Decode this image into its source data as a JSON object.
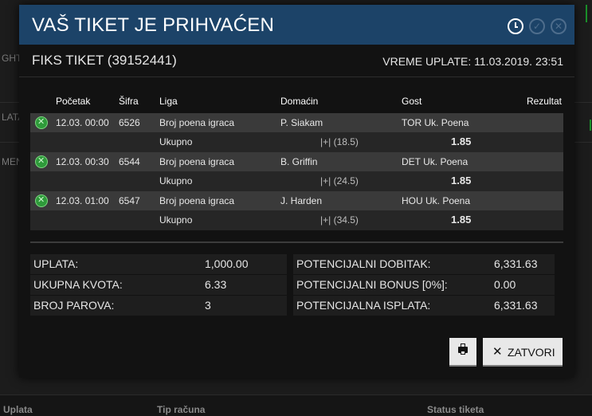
{
  "background": {
    "left_fragments": [
      "GHT",
      "LATA",
      "MEN"
    ],
    "footer_columns": [
      "Uplata",
      "Tip računa",
      "Status tiketa"
    ]
  },
  "modal": {
    "title": "VAŠ TIKET JE PRIHVAĆEN",
    "header_icons": [
      "clock-icon",
      "check-icon",
      "close-icon"
    ],
    "ticket_title": "FIKS TIKET (39152441)",
    "ticket_time": "VREME UPLATE: 11.03.2019. 23:51",
    "table": {
      "headers": [
        "Početak",
        "Šifra",
        "Liga",
        "Domaćin",
        "Gost",
        "Rezultat"
      ],
      "rows": [
        {
          "start": "12.03. 00:00",
          "code": "6526",
          "league": "Broj poena igraca",
          "home": "P. Siakam",
          "away": "TOR Uk. Poena",
          "bet": "Ukupno",
          "line": "|+| (18.5)",
          "odd": "1.85"
        },
        {
          "start": "12.03. 00:30",
          "code": "6544",
          "league": "Broj poena igraca",
          "home": "B. Griffin",
          "away": "DET Uk. Poena",
          "bet": "Ukupno",
          "line": "|+| (24.5)",
          "odd": "1.85"
        },
        {
          "start": "12.03. 01:00",
          "code": "6547",
          "league": "Broj poena igraca",
          "home": "J. Harden",
          "away": "HOU Uk. Poena",
          "bet": "Ukupno",
          "line": "|+| (34.5)",
          "odd": "1.85"
        }
      ]
    },
    "summary_left": [
      {
        "label": "UPLATA:",
        "value": "1,000.00"
      },
      {
        "label": "UKUPNA KVOTA:",
        "value": "6.33"
      },
      {
        "label": "BROJ PAROVA:",
        "value": "3"
      }
    ],
    "summary_right": [
      {
        "label": "POTENCIJALNI DOBITAK:",
        "value": "6,331.63"
      },
      {
        "label": "POTENCIJALNI BONUS [0%]:",
        "value": "0.00"
      },
      {
        "label": "POTENCIJALNA ISPLATA:",
        "value": "6,331.63"
      }
    ],
    "buttons": {
      "print_icon": "print-icon",
      "close_label": "ZATVORI"
    }
  },
  "colors": {
    "header_bg": "#1c4368",
    "match_row_bg": "#3a3a3a",
    "sub_row_bg": "#262626",
    "ball_icon": "#2e9a3a",
    "button_bg": "#e8e8e8"
  }
}
